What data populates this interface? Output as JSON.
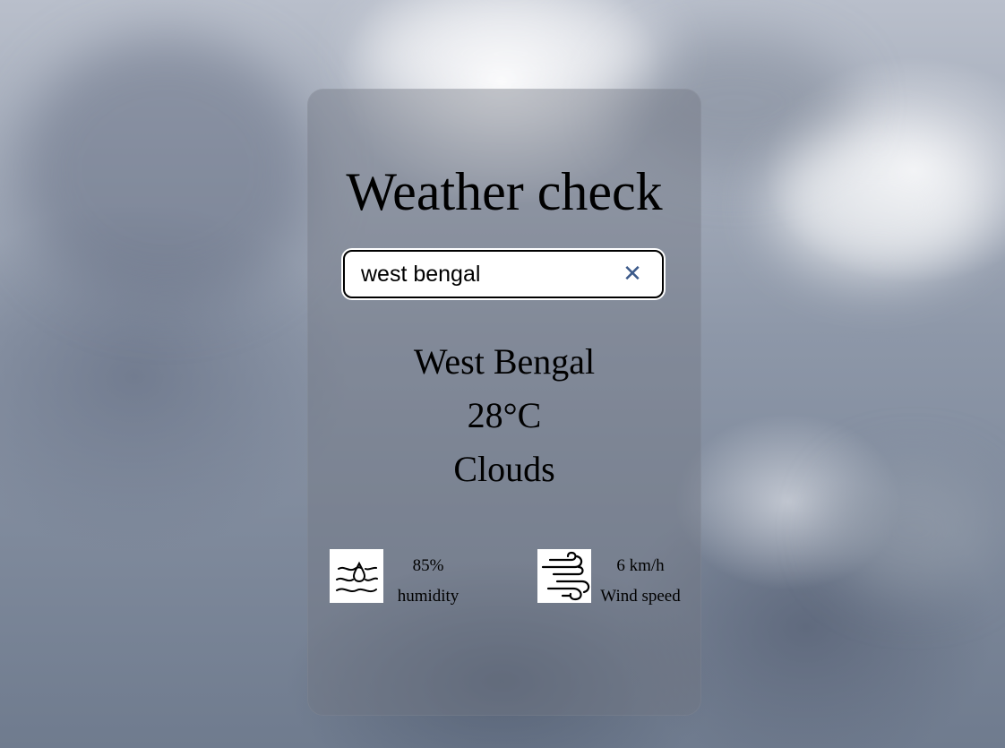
{
  "app": {
    "title": "Weather check"
  },
  "search": {
    "value": "west bengal",
    "clear_icon": "close-icon"
  },
  "weather": {
    "city": "West Bengal",
    "temperature": "28°C",
    "condition": "Clouds"
  },
  "stats": {
    "humidity": {
      "icon": "humidity-icon",
      "value": "85%",
      "label": "humidity"
    },
    "wind": {
      "icon": "wind-icon",
      "value": "6 km/h",
      "label": "Wind speed"
    }
  },
  "colors": {
    "clear_icon": "#3c5a8a",
    "card": "rgba(115,120,130,0.42)"
  }
}
